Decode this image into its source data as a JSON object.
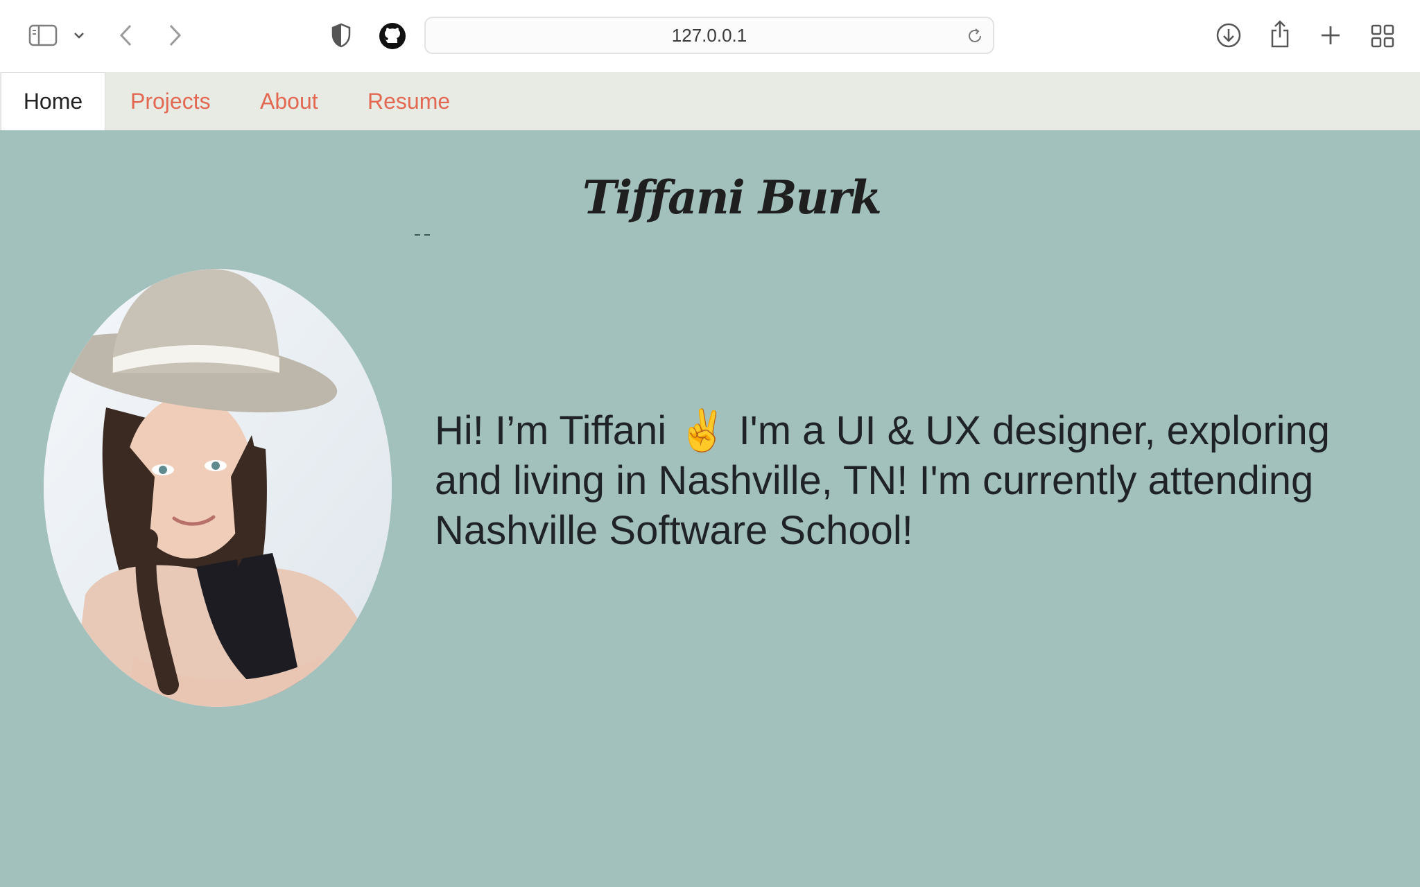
{
  "browser": {
    "url": "127.0.0.1",
    "icons": [
      "sidebar-icon",
      "chevron-down-icon",
      "back-icon",
      "forward-icon",
      "shield-icon",
      "github-icon",
      "reload-icon",
      "download-icon",
      "share-icon",
      "new-tab-icon",
      "tab-overview-icon"
    ]
  },
  "nav": {
    "items": [
      {
        "label": "Home",
        "active": true
      },
      {
        "label": "Projects",
        "active": false
      },
      {
        "label": "About",
        "active": false
      },
      {
        "label": "Resume",
        "active": false
      }
    ]
  },
  "main": {
    "title": "Tiffani Burk",
    "bio": "Hi! I’m Tiffani ✌️ I'm a UI & UX designer, exploring and living in Nashville, TN! I'm currently attending Nashville Software School!"
  },
  "colors": {
    "page_bg": "#a2c0bc",
    "nav_bg": "#e8ebe4",
    "nav_link": "#e36852",
    "text": "#1f2327"
  }
}
